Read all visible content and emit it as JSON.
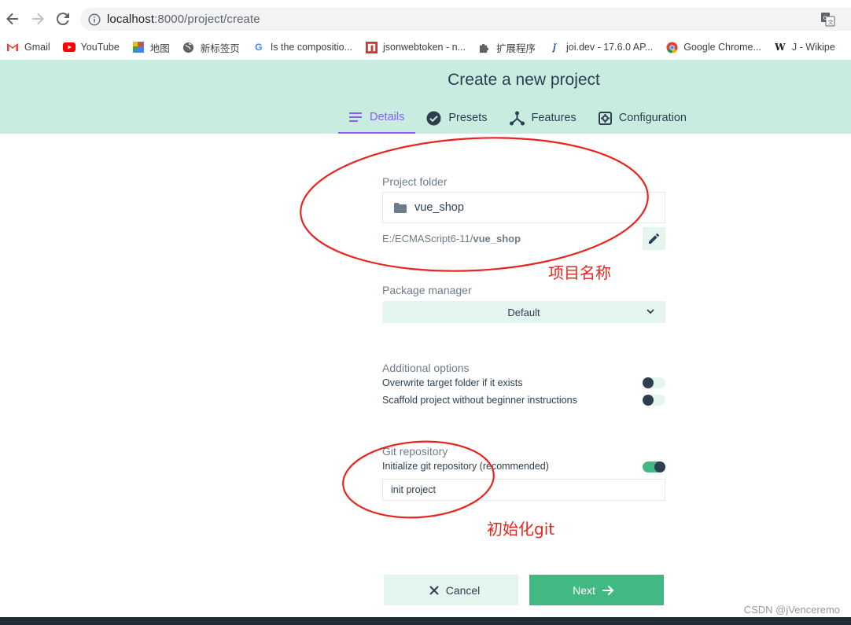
{
  "browser": {
    "url_host": "localhost",
    "url_rest": ":8000/project/create",
    "bookmarks": [
      {
        "label": "Gmail",
        "icon": "gmail-icon"
      },
      {
        "label": "YouTube",
        "icon": "youtube-icon"
      },
      {
        "label": "地图",
        "icon": "maps-icon"
      },
      {
        "label": "新标签页",
        "icon": "globe-icon"
      },
      {
        "label": "Is the compositio...",
        "icon": "google-icon"
      },
      {
        "label": "jsonwebtoken - n...",
        "icon": "npm-icon"
      },
      {
        "label": "扩展程序",
        "icon": "puzzle-icon"
      },
      {
        "label": "joi.dev - 17.6.0 AP...",
        "icon": "joi-icon"
      },
      {
        "label": "Google Chrome...",
        "icon": "chrome-icon"
      },
      {
        "label": "J - Wikipe",
        "icon": "wikipedia-icon"
      }
    ]
  },
  "header": {
    "title": "Create a new project",
    "tabs": [
      {
        "label": "Details",
        "icon": "list-icon"
      },
      {
        "label": "Presets",
        "icon": "check-circle-icon"
      },
      {
        "label": "Features",
        "icon": "fork-icon"
      },
      {
        "label": "Configuration",
        "icon": "settings-icon"
      }
    ]
  },
  "form": {
    "folder_label": "Project folder",
    "folder_value": "vue_shop",
    "path_prefix": "E:/ECMAScript6-11/",
    "path_name": "vue_shop",
    "package_label": "Package manager",
    "package_value": "Default",
    "options_label": "Additional options",
    "option_overwrite": "Overwrite target folder if it exists",
    "option_scaffold": "Scaffold project without beginner instructions",
    "git_label": "Git repository",
    "git_init": "Initialize git repository (recommended)",
    "git_commit_value": "init project",
    "cancel_label": "Cancel",
    "next_label": "Next"
  },
  "toggles": {
    "overwrite": false,
    "scaffold": false,
    "git_init": true
  },
  "annotations": {
    "folder_note": "项目名称",
    "git_note": "初始化git"
  },
  "watermark": "CSDN @jVenceremo",
  "colors": {
    "accent": "#42b983",
    "header_bg": "#c8ece0",
    "active_tab": "#8b5cf6",
    "annotation": "#e8251d"
  }
}
